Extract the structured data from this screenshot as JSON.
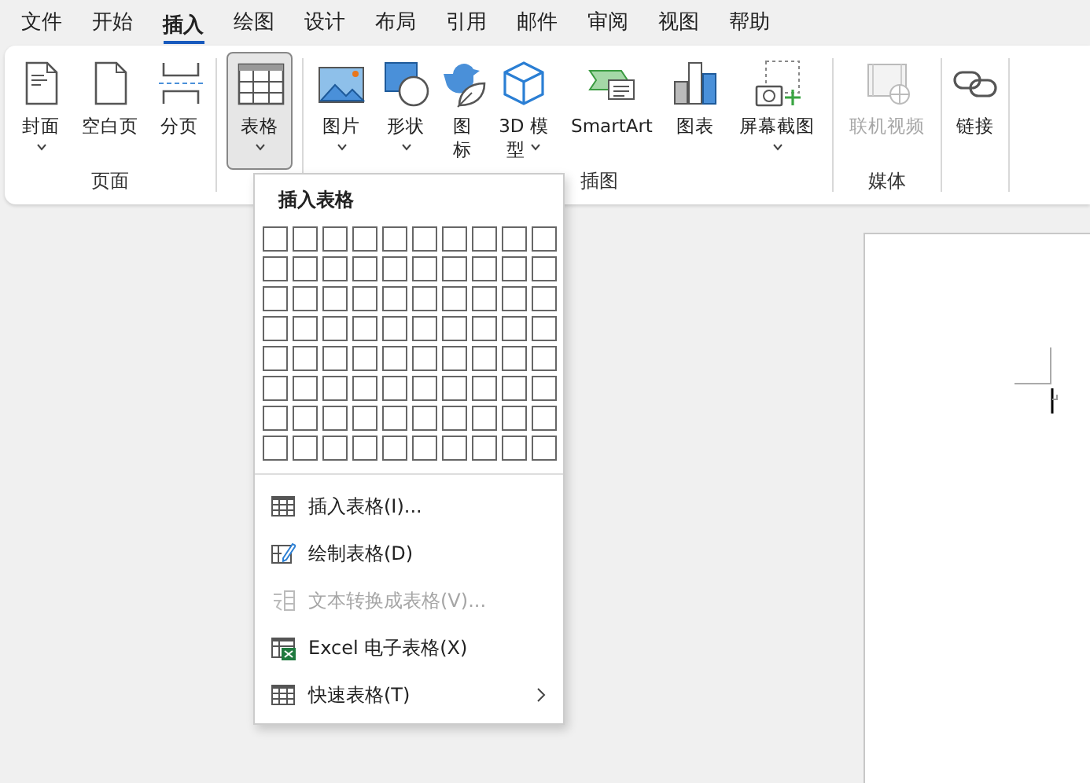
{
  "tabs": [
    {
      "label": "文件",
      "selected": false
    },
    {
      "label": "开始",
      "selected": false
    },
    {
      "label": "插入",
      "selected": true
    },
    {
      "label": "绘图",
      "selected": false
    },
    {
      "label": "设计",
      "selected": false
    },
    {
      "label": "布局",
      "selected": false
    },
    {
      "label": "引用",
      "selected": false
    },
    {
      "label": "邮件",
      "selected": false
    },
    {
      "label": "审阅",
      "selected": false
    },
    {
      "label": "视图",
      "selected": false
    },
    {
      "label": "帮助",
      "selected": false
    }
  ],
  "ribbon": {
    "groups": [
      {
        "label": "页面",
        "buttons": [
          {
            "kind": "cover",
            "label": "封面",
            "dropdown": true,
            "selected": false,
            "disabled": false
          },
          {
            "kind": "blank",
            "label": "空白页",
            "dropdown": false,
            "selected": false,
            "disabled": false
          },
          {
            "kind": "pagebreak",
            "label": "分页",
            "dropdown": false,
            "selected": false,
            "disabled": false
          }
        ]
      },
      {
        "buttons": [
          {
            "kind": "table",
            "label": "表格",
            "dropdown": true,
            "selected": true,
            "disabled": false
          }
        ]
      },
      {
        "label": "插图",
        "buttons": [
          {
            "kind": "picture",
            "label": "图片",
            "dropdown": true,
            "selected": false,
            "disabled": false
          },
          {
            "kind": "shapes",
            "label": "形状",
            "dropdown": true,
            "selected": false,
            "disabled": false
          },
          {
            "kind": "icons",
            "label": "图标",
            "dropdown": false,
            "selected": false,
            "disabled": false
          },
          {
            "kind": "model",
            "label": "3D 模型",
            "dropdown": true,
            "selected": false,
            "disabled": false
          },
          {
            "kind": "smartart",
            "label": "SmartArt",
            "dropdown": false,
            "selected": false,
            "disabled": false
          },
          {
            "kind": "chart",
            "label": "图表",
            "dropdown": false,
            "selected": false,
            "disabled": false
          },
          {
            "kind": "screenshot",
            "label": "屏幕截图",
            "dropdown": true,
            "selected": false,
            "disabled": false
          }
        ]
      },
      {
        "label": "媒体",
        "buttons": [
          {
            "kind": "video",
            "label": "联机视频",
            "dropdown": false,
            "selected": false,
            "disabled": true
          }
        ]
      },
      {
        "buttons": [
          {
            "kind": "link",
            "label": "链接",
            "dropdown": false,
            "selected": false,
            "disabled": false
          }
        ]
      }
    ]
  },
  "menu": {
    "title": "插入表格",
    "items": [
      {
        "kind": "insert",
        "label": "插入表格(I)...",
        "disabled": false,
        "submenu": false
      },
      {
        "kind": "draw",
        "label": "绘制表格(D)",
        "disabled": false,
        "submenu": false
      },
      {
        "kind": "convert",
        "label": "文本转换成表格(V)...",
        "disabled": true,
        "submenu": false
      },
      {
        "kind": "excel",
        "label": "Excel 电子表格(X)",
        "disabled": false,
        "submenu": false
      },
      {
        "kind": "quick",
        "label": "快速表格(T)",
        "disabled": false,
        "submenu": true
      }
    ]
  }
}
